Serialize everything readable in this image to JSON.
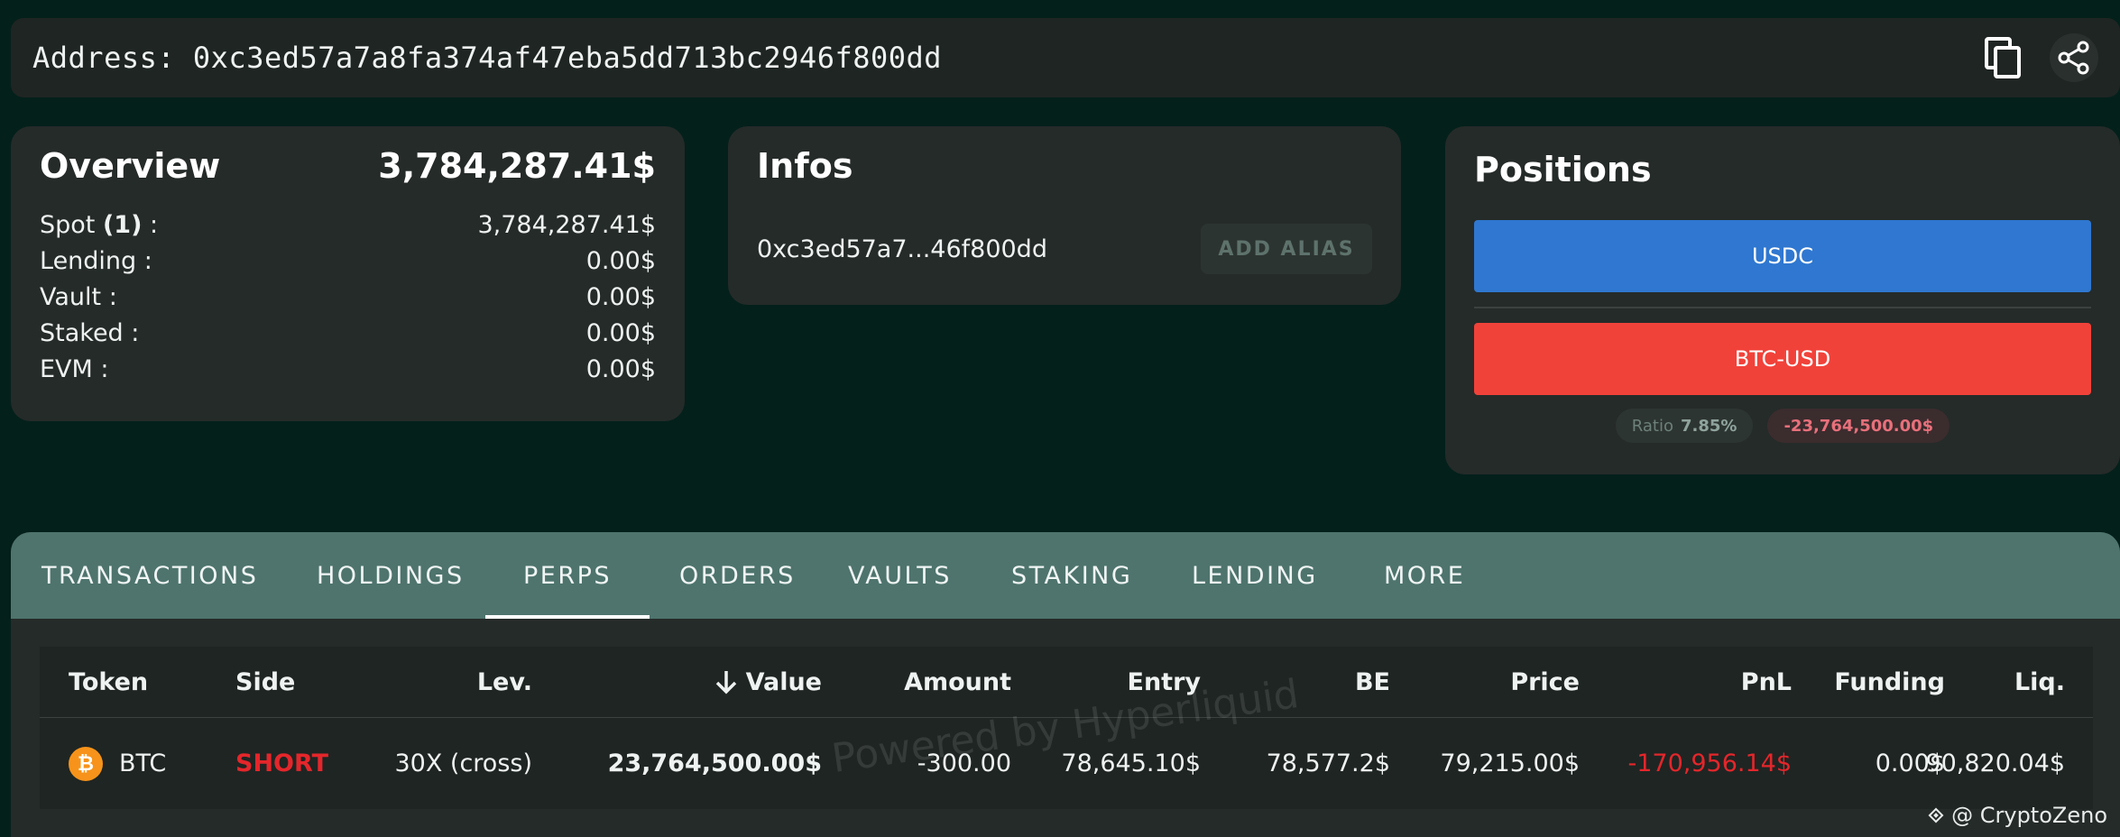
{
  "address_bar": {
    "text": "Address: 0xc3ed57a7a8fa374af47eba5dd713bc2946f800dd",
    "copy_icon": "copy-icon",
    "share_icon": "share-icon"
  },
  "overview": {
    "title": "Overview",
    "total": "3,784,287.41$",
    "rows": [
      {
        "label_prefix": "Spot ",
        "label_bold": "(1)",
        "label_suffix": " :",
        "value": "3,784,287.41$"
      },
      {
        "label": "Lending :",
        "value": "0.00$"
      },
      {
        "label": "Vault :",
        "value": "0.00$"
      },
      {
        "label": "Staked :",
        "value": "0.00$"
      },
      {
        "label": "EVM :",
        "value": "0.00$"
      }
    ]
  },
  "infos": {
    "title": "Infos",
    "short_address": "0xc3ed57a7...46f800dd",
    "alias_button": "ADD ALIAS"
  },
  "positions": {
    "title": "Positions",
    "bars": [
      "USDC",
      "BTC-USD"
    ],
    "ratio_label": "Ratio",
    "ratio_value": "7.85%",
    "net_value": "-23,764,500.00$",
    "colors": {
      "usdc": "#2f77d0",
      "btc": "#f1423a"
    }
  },
  "tabs": [
    "TRANSACTIONS",
    "HOLDINGS",
    "PERPS",
    "ORDERS",
    "VAULTS",
    "STAKING",
    "LENDING",
    "MORE"
  ],
  "active_tab": "PERPS",
  "table": {
    "headers": [
      "Token",
      "Side",
      "Lev.",
      "Value",
      "Amount",
      "Entry",
      "BE",
      "Price",
      "PnL",
      "Funding",
      "Liq."
    ],
    "sort_icon": "arrow-down-icon",
    "rows": [
      {
        "token": "BTC",
        "token_icon": "bitcoin-icon",
        "side": "SHORT",
        "lev": "30X (cross)",
        "value": "23,764,500.00$",
        "amount": "-300.00",
        "entry": "78,645.10$",
        "be": "78,577.2$",
        "price": "79,215.00$",
        "pnl": "-170,956.14$",
        "funding": "0.00$",
        "liq": "90,820.04$"
      }
    ]
  },
  "watermark": "Powered by Hyperliquid",
  "credit": "@ CryptoZeno"
}
